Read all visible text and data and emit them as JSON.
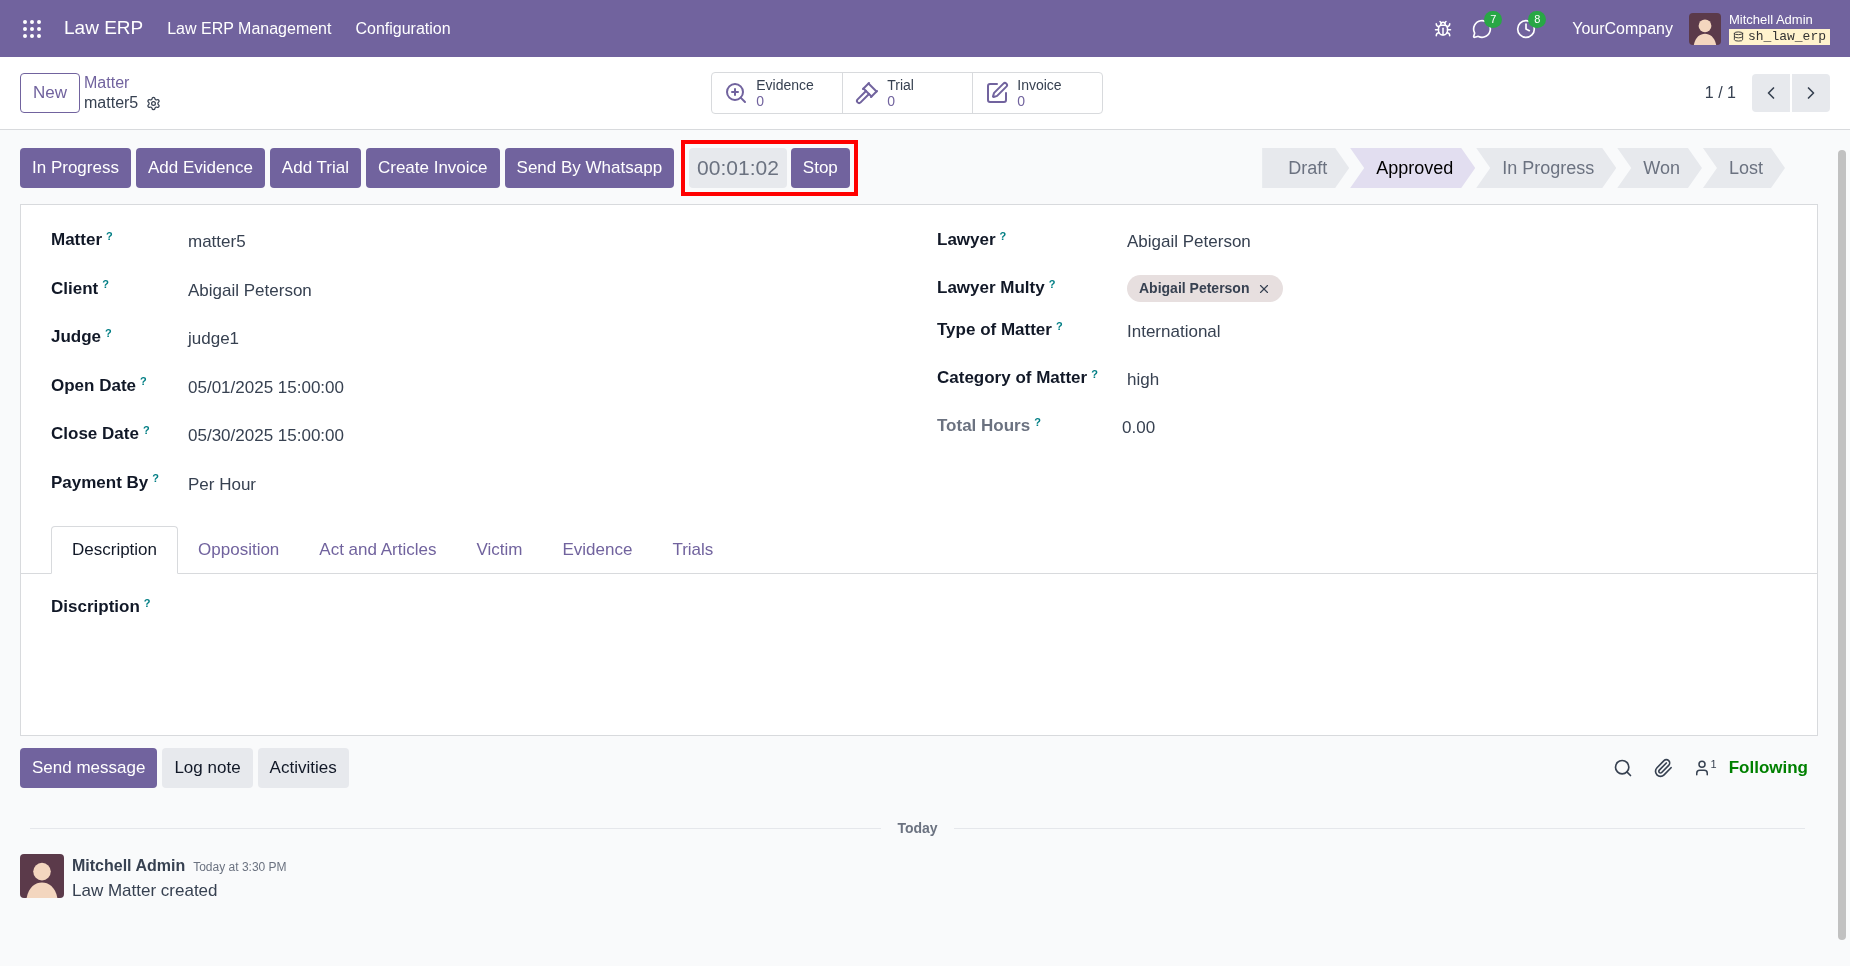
{
  "navbar": {
    "app_name": "Law ERP",
    "menus": [
      "Law ERP Management",
      "Configuration"
    ],
    "messages_count": "7",
    "activities_count": "8",
    "company": "YourCompany",
    "user": "Mitchell Admin",
    "database": "sh_law_erp"
  },
  "control_panel": {
    "new_button": "New",
    "breadcrumb": "Matter",
    "record_name": "matter5",
    "smart_buttons": [
      {
        "kind": "evidence",
        "label": "Evidence",
        "count": "0"
      },
      {
        "kind": "trial",
        "label": "Trial",
        "count": "0"
      },
      {
        "kind": "invoice",
        "label": "Invoice",
        "count": "0"
      }
    ],
    "pager": "1 / 1"
  },
  "header_buttons": [
    "In Progress",
    "Add Evidence",
    "Add Trial",
    "Create Invoice",
    "Send By Whatsapp"
  ],
  "timer": {
    "value": "00:01:02",
    "button": "Stop"
  },
  "stages": [
    {
      "label": "Draft",
      "selected": false
    },
    {
      "label": "Approved",
      "selected": true
    },
    {
      "label": "In Progress",
      "selected": false
    },
    {
      "label": "Won",
      "selected": false
    },
    {
      "label": "Lost",
      "selected": false
    }
  ],
  "left_fields": [
    {
      "label": "Matter",
      "value": "matter5"
    },
    {
      "label": "Client",
      "value": "Abigail Peterson"
    },
    {
      "label": "Judge",
      "value": "judge1"
    },
    {
      "label": "Open Date",
      "value": "05/01/2025 15:00:00"
    },
    {
      "label": "Close Date",
      "value": "05/30/2025 15:00:00"
    },
    {
      "label": "Payment By",
      "value": "Per Hour"
    }
  ],
  "right_fields": [
    {
      "kind": "text",
      "label": "Lawyer",
      "value": "Abigail Peterson",
      "disabled": false
    },
    {
      "kind": "tags",
      "label": "Lawyer Multy",
      "value": "Abigail Peterson",
      "disabled": false
    },
    {
      "kind": "text",
      "label": "Type of Matter",
      "value": "International",
      "disabled": false
    },
    {
      "kind": "text",
      "label": "Category of Matter",
      "value": "high",
      "disabled": false
    },
    {
      "kind": "text",
      "label": "Total Hours",
      "value": "0.00",
      "disabled": true
    }
  ],
  "tabs": [
    {
      "label": "Description",
      "selected": true
    },
    {
      "label": "Opposition",
      "selected": false
    },
    {
      "label": "Act and Articles",
      "selected": false
    },
    {
      "label": "Victim",
      "selected": false
    },
    {
      "label": "Evidence",
      "selected": false
    },
    {
      "label": "Trials",
      "selected": false
    }
  ],
  "tab_content": {
    "label": "Discription"
  },
  "help_mark": "?",
  "chatter": {
    "buttons": [
      {
        "label": "Send message",
        "selected": true
      },
      {
        "label": "Log note",
        "selected": false
      },
      {
        "label": "Activities",
        "selected": false
      }
    ],
    "followers_count": "1",
    "following": "Following",
    "separator": "Today",
    "messages": [
      {
        "author": "Mitchell Admin",
        "time": "Today at 3:30 PM",
        "body": "Law Matter created"
      }
    ]
  }
}
